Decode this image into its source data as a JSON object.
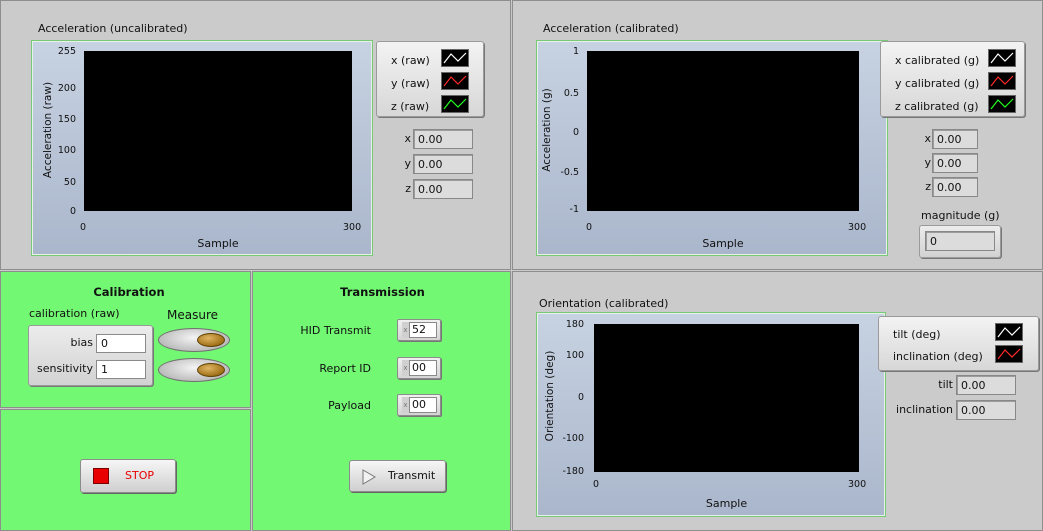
{
  "accel_raw": {
    "title": "Acceleration (uncalibrated)",
    "ylabel": "Acceleration (raw)",
    "xlabel": "Sample",
    "yticks": [
      "255",
      "200",
      "150",
      "100",
      "50",
      "0"
    ],
    "xticks": [
      "0",
      "300"
    ],
    "legend": [
      "x (raw)",
      "y (raw)",
      "z (raw)"
    ],
    "indicators": [
      {
        "label": "x",
        "value": "0.00"
      },
      {
        "label": "y",
        "value": "0.00"
      },
      {
        "label": "z",
        "value": "0.00"
      }
    ]
  },
  "accel_cal": {
    "title": "Acceleration (calibrated)",
    "ylabel": "Acceleration (g)",
    "xlabel": "Sample",
    "yticks": [
      "1",
      "0.5",
      "0",
      "-0.5",
      "-1"
    ],
    "xticks": [
      "0",
      "300"
    ],
    "legend": [
      "x calibrated (g)",
      "y calibrated (g)",
      "z calibrated (g)"
    ],
    "indicators": [
      {
        "label": "x",
        "value": "0.00"
      },
      {
        "label": "y",
        "value": "0.00"
      },
      {
        "label": "z",
        "value": "0.00"
      }
    ],
    "magnitude_label": "magnitude (g)",
    "magnitude_value": "0"
  },
  "calibration": {
    "title": "Calibration",
    "group_label": "calibration (raw)",
    "bias_label": "bias",
    "bias_value": "0",
    "sensitivity_label": "sensitivity",
    "sensitivity_value": "1",
    "measure_label": "Measure"
  },
  "stop": {
    "label": "STOP"
  },
  "transmission": {
    "title": "Transmission",
    "hid_label": "HID Transmit",
    "hid_value": "52",
    "report_label": "Report ID",
    "report_value": "00",
    "payload_label": "Payload",
    "payload_value": "00",
    "radix": "x",
    "transmit_label": "Transmit"
  },
  "orientation": {
    "title": "Orientation (calibrated)",
    "ylabel": "Orientation (deg)",
    "xlabel": "Sample",
    "yticks": [
      "180",
      "100",
      "0",
      "-100",
      "-180"
    ],
    "xticks": [
      "0",
      "300"
    ],
    "legend": [
      "tilt (deg)",
      "inclination (deg)"
    ],
    "tilt_label": "tilt",
    "tilt_value": "0.00",
    "inclination_label": "inclination",
    "inclination_value": "0.00"
  },
  "colors": {
    "series_white": "#ffffff",
    "series_red": "#ff2a2a",
    "series_green": "#22ff22",
    "panel_green": "#73f873",
    "plot_bg": "#000000"
  },
  "icons": {
    "stop": "stop-square-icon",
    "transmit": "play-triangle-icon"
  }
}
